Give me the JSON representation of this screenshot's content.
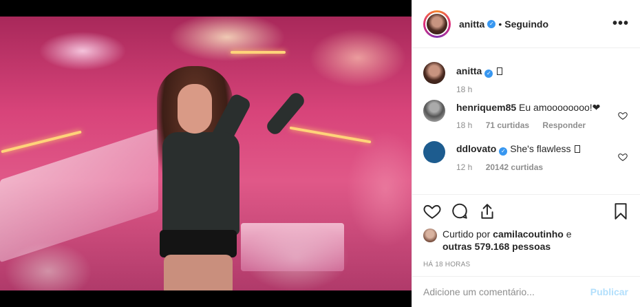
{
  "post": {
    "author": "anitta",
    "follow_status": "Seguindo",
    "separator": "•",
    "more_label": "•••",
    "caption_age": "18 h"
  },
  "comments": [
    {
      "username": "henriquem85",
      "text": "Eu amoooooooo!❤",
      "age": "18 h",
      "likes": "71 curtidas",
      "reply_label": "Responder"
    },
    {
      "username": "ddlovato",
      "text": "She's flawless",
      "age": "12 h",
      "likes": "20142 curtidas"
    }
  ],
  "likes": {
    "prefix": "Curtido por",
    "user": "camilacoutinho",
    "conjunction": "e",
    "others": "outras 579.168 pessoas"
  },
  "timestamp": "Há 18 horas",
  "comment_box": {
    "placeholder": "Adicione um comentário...",
    "publish_label": "Publicar"
  },
  "colors": {
    "verified": "#3897f0",
    "publish_disabled": "#b2dffc",
    "secondary_text": "#8e8e8e"
  }
}
